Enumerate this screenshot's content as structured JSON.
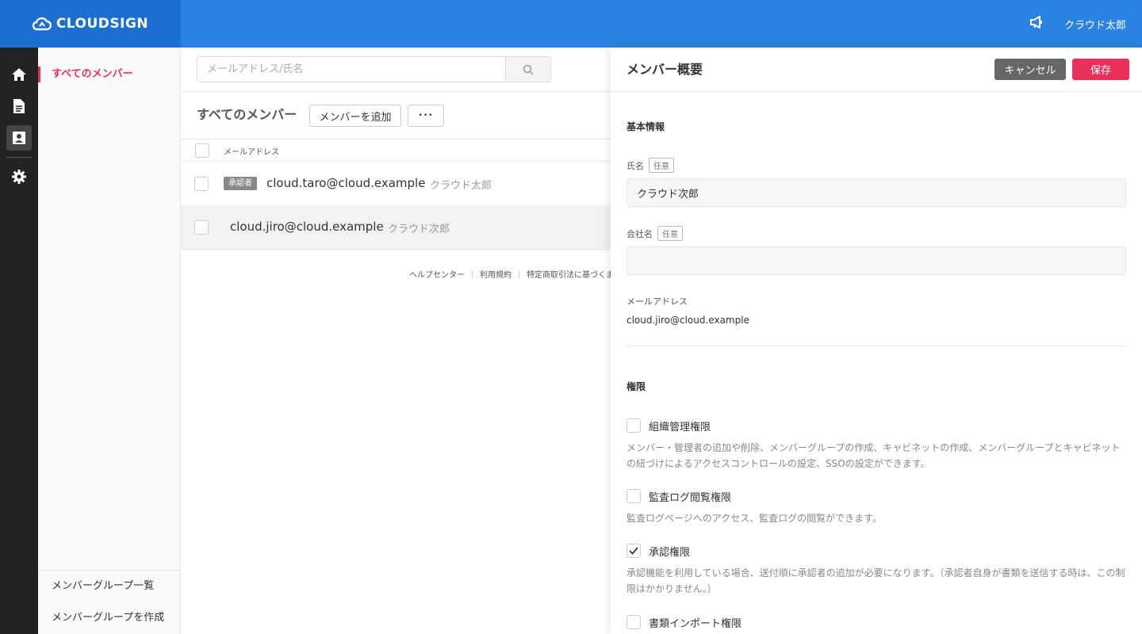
{
  "header": {
    "logo_text": "CLOUDSIGN",
    "user_name": "クラウド太郎"
  },
  "colors": {
    "header_blue": "#2a83e0",
    "logo_blue": "#1a6fd1",
    "accent_pink": "#e8305a"
  },
  "rail": {
    "icons": [
      "home-icon",
      "document-icon",
      "contact-card-icon",
      "gear-icon"
    ]
  },
  "sidebar": {
    "active_item": "すべてのメンバー",
    "bottom_items": [
      "メンバーグループ一覧",
      "メンバーグループを作成"
    ]
  },
  "main": {
    "search": {
      "placeholder": "メールアドレス/氏名"
    },
    "list_title": "すべてのメンバー",
    "add_member_label": "メンバーを追加",
    "more_label": "•••",
    "column_email": "メールアドレス",
    "rows": [
      {
        "badge": "承認者",
        "email": "cloud.taro@cloud.example",
        "name": "クラウド太郎"
      },
      {
        "badge": "",
        "email": "cloud.jiro@cloud.example",
        "name": "クラウド次郎"
      }
    ],
    "footer_links": [
      "ヘルプセンター",
      "利用規約",
      "特定商取引法に基づくま"
    ]
  },
  "panel": {
    "title": "メンバー概要",
    "cancel_label": "キャンセル",
    "save_label": "保存",
    "basic_info_title": "基本情報",
    "optional_tag": "任意",
    "name_label": "氏名",
    "name_value": "クラウド次郎",
    "company_label": "会社名",
    "company_value": "",
    "email_label": "メールアドレス",
    "email_value": "cloud.jiro@cloud.example",
    "permissions_title": "権限",
    "permissions": [
      {
        "label": "組織管理権限",
        "checked": false,
        "desc": "メンバー・管理者の追加や削除、メンバーグループの作成、キャビネットの作成、メンバーグループとキャビネットの紐づけによるアクセスコントロールの設定、SSOの設定ができます。"
      },
      {
        "label": "監査ログ閲覧権限",
        "checked": false,
        "desc": "監査ログページへのアクセス、監査ログの閲覧ができます。"
      },
      {
        "label": "承認権限",
        "checked": true,
        "desc": "承認機能を利用している場合、送付順に承認者の追加が必要になります。（承認者自身が書類を送信する時は、この制限はかかりません。）"
      },
      {
        "label": "書類インポート権限",
        "checked": false,
        "desc": ""
      }
    ]
  }
}
